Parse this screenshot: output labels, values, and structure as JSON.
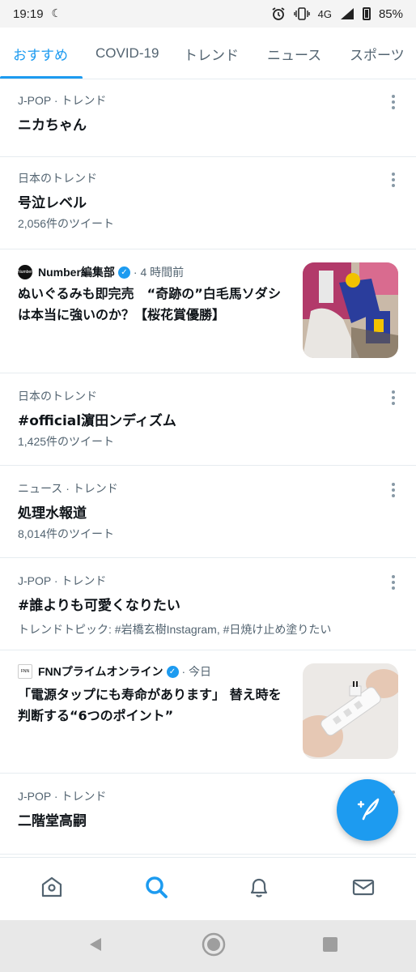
{
  "status_bar": {
    "time": "19:19",
    "network": "4G",
    "battery": "85%"
  },
  "tabs": [
    {
      "label": "おすすめ",
      "active": true
    },
    {
      "label": "COVID-19",
      "active": false
    },
    {
      "label": "トレンド",
      "active": false
    },
    {
      "label": "ニュース",
      "active": false
    },
    {
      "label": "スポーツ",
      "active": false
    }
  ],
  "feed": {
    "items": [
      {
        "type": "trend",
        "meta": "J-POP · トレンド",
        "title": "ニカちゃん"
      },
      {
        "type": "trend",
        "meta": "日本のトレンド",
        "title": "号泣レベル",
        "sub": "2,056件のツイート"
      },
      {
        "type": "news",
        "source": "Number編集部",
        "logo_text": "Number",
        "time": "· 4 時間前",
        "headline": "ぬいぐるみも即完売　“奇跡の”白毛馬ソダシは本当に強いのか？【桜花賞優勝】"
      },
      {
        "type": "trend",
        "meta": "日本のトレンド",
        "title": "#official濵田ンディズム",
        "sub": "1,425件のツイート"
      },
      {
        "type": "trend",
        "meta": "ニュース · トレンド",
        "title": "処理水報道",
        "sub": "8,014件のツイート"
      },
      {
        "type": "trend",
        "meta": "J-POP · トレンド",
        "title": "#誰よりも可愛くなりたい",
        "sub": "トレンドトピック: #岩橋玄樹Instagram, #日焼け止め塗りたい"
      },
      {
        "type": "news",
        "source": "FNNプライムオンライン",
        "logo_text": "FNN",
        "time": "· 今日",
        "headline": "「電源タップにも寿命があります」 替え時を判断する“6つのポイント”"
      },
      {
        "type": "trend",
        "meta": "J-POP · トレンド",
        "title": "二階堂高嗣"
      }
    ]
  },
  "colors": {
    "accent": "#1d9bf0",
    "text_primary": "#0f1419",
    "text_secondary": "#536471",
    "divider": "#e6ecf0"
  },
  "icons": {
    "fab": "compose-tweet-icon",
    "nav": [
      "home-icon",
      "search-icon",
      "notifications-bell-icon",
      "messages-envelope-icon"
    ],
    "system": [
      "back-triangle-icon",
      "home-circle-icon",
      "recents-square-icon"
    ]
  }
}
